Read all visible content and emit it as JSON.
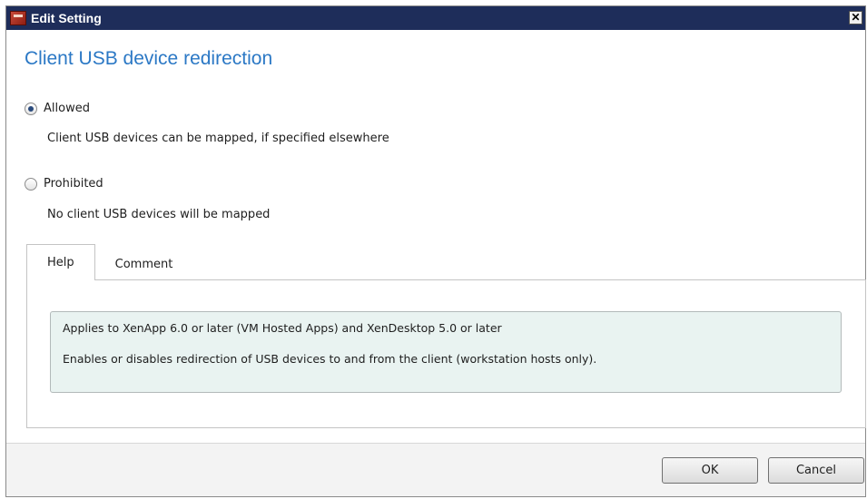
{
  "window": {
    "title": "Edit Setting",
    "close_glyph": "✕"
  },
  "heading": "Client USB device redirection",
  "options": [
    {
      "label": "Allowed",
      "description": "Client USB devices can be mapped, if specified elsewhere",
      "selected": true
    },
    {
      "label": "Prohibited",
      "description": "No client USB devices will be mapped",
      "selected": false
    }
  ],
  "tabs": [
    {
      "label": "Help",
      "active": true
    },
    {
      "label": "Comment",
      "active": false
    }
  ],
  "help": {
    "line1": "Applies to XenApp 6.0 or later (VM Hosted Apps) and XenDesktop 5.0 or later",
    "line2": "Enables or disables redirection of USB devices to and from the client (workstation hosts only)."
  },
  "buttons": {
    "ok": "OK",
    "cancel": "Cancel"
  },
  "colors": {
    "titlebar": "#1e2d5a",
    "heading": "#2b78c5",
    "help_bg": "#e9f3f1"
  }
}
